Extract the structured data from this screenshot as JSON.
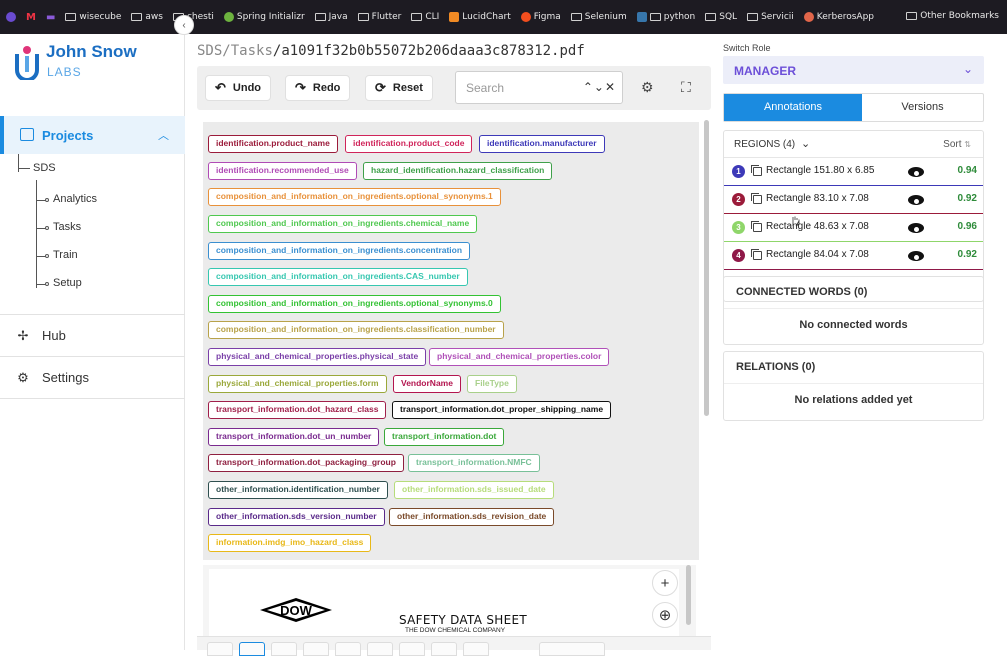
{
  "bookmarks": {
    "items": [
      "wisecube",
      "aws",
      "chesti",
      "Spring Initializr",
      "Java",
      "Flutter",
      "CLI",
      "LucidChart",
      "Figma",
      "Selenium",
      "python",
      "SQL",
      "Servicii",
      "KerberosApp"
    ],
    "other": "Other Bookmarks"
  },
  "brand": {
    "line1": "John Snow",
    "line2": "LABS"
  },
  "sidebar": {
    "projects": "Projects",
    "tree_root": "SDS",
    "tree_items": [
      "Analytics",
      "Tasks",
      "Train",
      "Setup"
    ],
    "hub": "Hub",
    "settings": "Settings"
  },
  "breadcrumb": {
    "project": "SDS",
    "sep1": "/",
    "section": "Tasks",
    "sep2": "/",
    "file": "a1091f32b0b55072b206daaa3c878312.pdf"
  },
  "toolbar": {
    "undo": "Undo",
    "redo": "Redo",
    "reset": "Reset",
    "search_placeholder": "Search",
    "search_controls": "⌃⌄✕"
  },
  "labels": [
    {
      "text": "identification.product_name",
      "color": "#9b1b3a"
    },
    {
      "text": "identification.product_code",
      "color": "#d0245a"
    },
    {
      "text": "identification.manufacturer",
      "color": "#3d39b8"
    },
    {
      "text": "identification.recommended_use",
      "color": "#b04bb5"
    },
    {
      "text": "hazard_identification.hazard_classification",
      "color": "#3fa04a"
    },
    {
      "text": "composition_and_information_on_ingredients.optional_synonyms.1",
      "color": "#e8913a"
    },
    {
      "text": "composition_and_information_on_ingredients.chemical_name",
      "color": "#4fc84f"
    },
    {
      "text": "composition_and_information_on_ingredients.concentration",
      "color": "#3a8fd0"
    },
    {
      "text": "composition_and_information_on_ingredients.CAS_number",
      "color": "#36c7b0"
    },
    {
      "text": "composition_and_information_on_ingredients.optional_synonyms.0",
      "color": "#33c233"
    },
    {
      "text": "composition_and_information_on_ingredients.classification_number",
      "color": "#b8a24a"
    },
    {
      "text": "physical_and_chemical_properties.physical_state",
      "color": "#7a3fa8"
    },
    {
      "text": "physical_and_chemical_properties.color",
      "color": "#b050b8"
    },
    {
      "text": "physical_and_chemical_properties.form",
      "color": "#9aa83a"
    },
    {
      "text": "VendorName",
      "color": "#b3154f"
    },
    {
      "text": "FileType",
      "color": "#a8d08a"
    },
    {
      "text": "transport_information.dot_hazard_class",
      "color": "#a01f4a"
    },
    {
      "text": "transport_information.dot_proper_shipping_name",
      "color": "#111111"
    },
    {
      "text": "transport_information.dot_un_number",
      "color": "#7a2a8f"
    },
    {
      "text": "transport_information.dot",
      "color": "#3aa83a"
    },
    {
      "text": "transport_information.dot_packaging_group",
      "color": "#8f2040"
    },
    {
      "text": "transport_information.NMFC",
      "color": "#78c098"
    },
    {
      "text": "other_information.identification_number",
      "color": "#2f4f4f"
    },
    {
      "text": "other_information.sds_issued_date",
      "color": "#b6dc7a"
    },
    {
      "text": "other_information.sds_version_number",
      "color": "#5a2a8a"
    },
    {
      "text": "other_information.sds_revision_date",
      "color": "#7a4a2a"
    },
    {
      "text": "information.imdg_imo_hazard_class",
      "color": "#e8b818"
    }
  ],
  "document": {
    "logo": "DOW",
    "title": "SAFETY DATA SHEET",
    "company": "THE DOW CHEMICAL COMPANY"
  },
  "zoom": {
    "in": "+",
    "fit": "⊕"
  },
  "right": {
    "switch_role_label": "Switch Role",
    "role": "MANAGER",
    "tab_annotations": "Annotations",
    "tab_versions": "Versions",
    "regions_title": "REGIONS (4)",
    "sort_label": "Sort",
    "regions": [
      {
        "num": "1",
        "name": "Rectangle 151.80 x 6.85",
        "score": "0.94",
        "color": "#3d39b8"
      },
      {
        "num": "2",
        "name": "Rectangle 83.10 x 7.08",
        "score": "0.92",
        "color": "#9b1b3a"
      },
      {
        "num": "3",
        "name": "Rectangle 48.63 x 7.08",
        "score": "0.96",
        "color": "#8fd66a"
      },
      {
        "num": "4",
        "name": "Rectangle 84.04 x 7.08",
        "score": "0.92",
        "color": "#8f1848"
      }
    ],
    "connected_title": "CONNECTED WORDS (0)",
    "connected_empty": "No connected words",
    "relations_title": "RELATIONS (0)",
    "relations_empty": "No relations added yet"
  }
}
